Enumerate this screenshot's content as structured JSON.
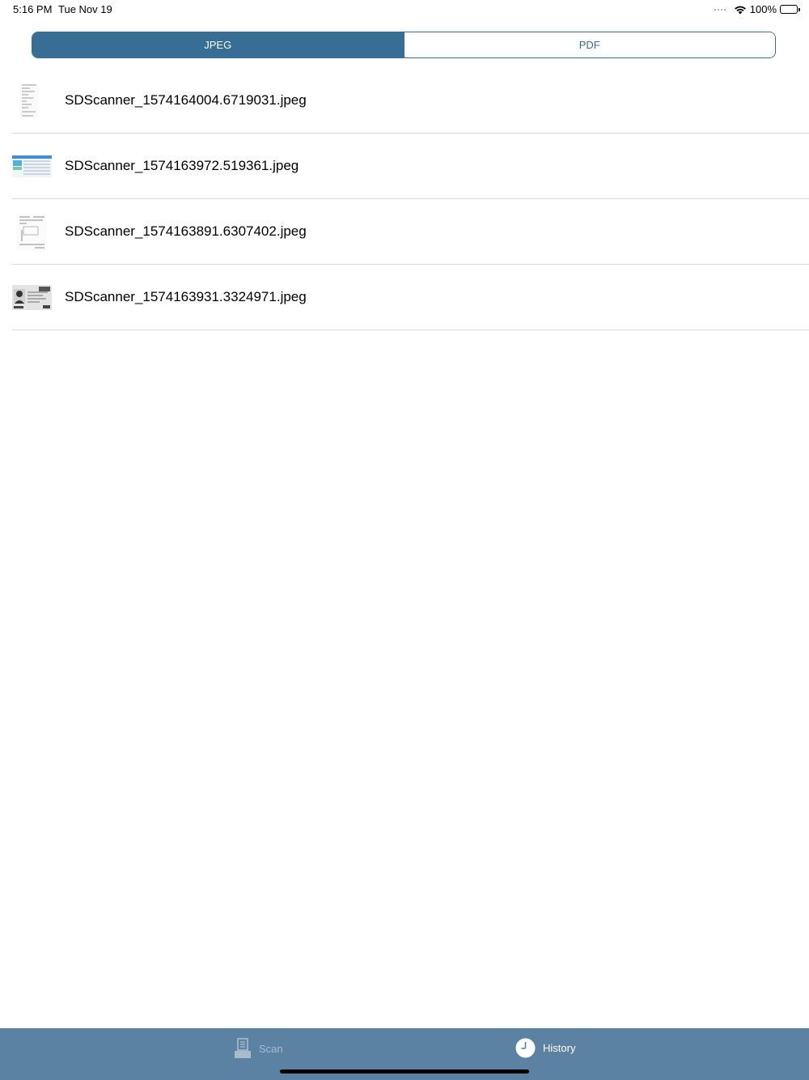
{
  "status_bar": {
    "time": "5:16 PM",
    "date": "Tue Nov 19",
    "battery_label": "100%",
    "battery_level": 1.0
  },
  "segmented_control": {
    "segments": [
      {
        "label": "JPEG",
        "selected": true
      },
      {
        "label": "PDF",
        "selected": false
      }
    ],
    "accent_color": "#386d95"
  },
  "files": [
    {
      "name": "SDScanner_1574164004.6719031.jpeg",
      "thumb": "receipt-thumbnail"
    },
    {
      "name": "SDScanner_1574163972.519361.jpeg",
      "thumb": "web-form-thumbnail"
    },
    {
      "name": "SDScanner_1574163891.6307402.jpeg",
      "thumb": "document-thumbnail"
    },
    {
      "name": "SDScanner_1574163931.3324971.jpeg",
      "thumb": "id-card-thumbnail"
    }
  ],
  "tab_bar": {
    "background": "#5b82a3",
    "tabs": [
      {
        "label": "Scan",
        "icon": "scanner-icon",
        "selected": false
      },
      {
        "label": "History",
        "icon": "clock-icon",
        "selected": true
      }
    ]
  }
}
